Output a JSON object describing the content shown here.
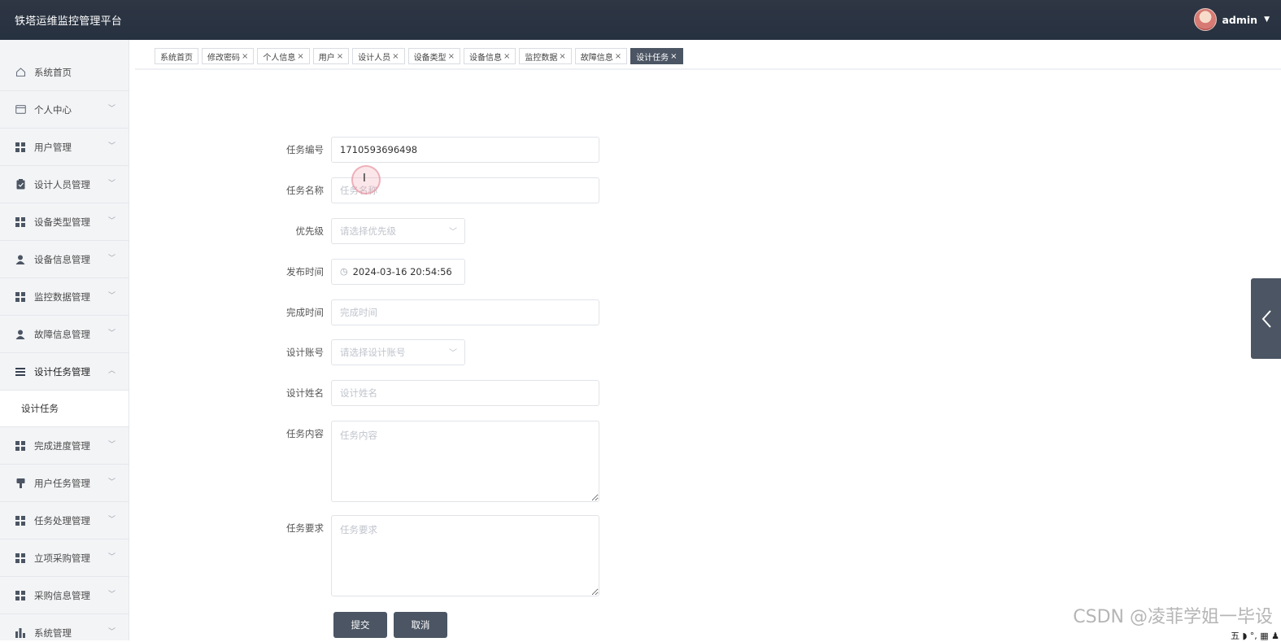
{
  "header": {
    "app_title": "铁塔运维监控管理平台",
    "username": "admin",
    "caret_icon": "caret-down-icon"
  },
  "sidebar": {
    "items": [
      {
        "label": "系统首页",
        "icon": "home-icon",
        "expandable": false
      },
      {
        "label": "个人中心",
        "icon": "card-icon",
        "expandable": true
      },
      {
        "label": "用户管理",
        "icon": "grid-icon",
        "expandable": true
      },
      {
        "label": "设计人员管理",
        "icon": "clipboard-icon",
        "expandable": true
      },
      {
        "label": "设备类型管理",
        "icon": "grid-icon",
        "expandable": true
      },
      {
        "label": "设备信息管理",
        "icon": "person-icon",
        "expandable": true
      },
      {
        "label": "监控数据管理",
        "icon": "grid-icon",
        "expandable": true
      },
      {
        "label": "故障信息管理",
        "icon": "person-icon",
        "expandable": true
      },
      {
        "label": "设计任务管理",
        "icon": "list-icon",
        "expandable": true,
        "expanded": true
      },
      {
        "label": "完成进度管理",
        "icon": "grid-icon",
        "expandable": true
      },
      {
        "label": "用户任务管理",
        "icon": "pin-icon",
        "expandable": true
      },
      {
        "label": "任务处理管理",
        "icon": "grid-icon",
        "expandable": true
      },
      {
        "label": "立项采购管理",
        "icon": "grid-icon",
        "expandable": true
      },
      {
        "label": "采购信息管理",
        "icon": "grid-icon",
        "expandable": true
      },
      {
        "label": "系统管理",
        "icon": "bar-chart-icon",
        "expandable": true
      }
    ],
    "submenu": {
      "label": "设计任务"
    }
  },
  "tabs": [
    {
      "label": "系统首页",
      "closable": false
    },
    {
      "label": "修改密码",
      "closable": true
    },
    {
      "label": "个人信息",
      "closable": true
    },
    {
      "label": "用户",
      "closable": true
    },
    {
      "label": "设计人员",
      "closable": true
    },
    {
      "label": "设备类型",
      "closable": true
    },
    {
      "label": "设备信息",
      "closable": true
    },
    {
      "label": "监控数据",
      "closable": true
    },
    {
      "label": "故障信息",
      "closable": true
    },
    {
      "label": "设计任务",
      "closable": true,
      "active": true
    }
  ],
  "tab_close_glyph": "×",
  "form": {
    "task_no": {
      "label": "任务编号",
      "value": "1710593696498"
    },
    "task_name": {
      "label": "任务名称",
      "placeholder": "任务名称"
    },
    "priority": {
      "label": "优先级",
      "placeholder": "请选择优先级"
    },
    "publish_time": {
      "label": "发布时间",
      "value": "2024-03-16 20:54:56"
    },
    "finish_time": {
      "label": "完成时间",
      "placeholder": "完成时间"
    },
    "design_account": {
      "label": "设计账号",
      "placeholder": "请选择设计账号"
    },
    "design_name": {
      "label": "设计姓名",
      "placeholder": "设计姓名"
    },
    "task_content": {
      "label": "任务内容",
      "placeholder": "任务内容"
    },
    "task_requirement": {
      "label": "任务要求",
      "placeholder": "任务要求"
    },
    "submit_label": "提交",
    "cancel_label": "取消"
  },
  "watermark": "CSDN @凌菲学姐一毕设",
  "tray_text": "五 ◗ °, ▦ ♟",
  "colors": {
    "header_bg": "#2b3340",
    "accent": "#4b5563",
    "sidebar_bg": "#f3f4f6"
  }
}
